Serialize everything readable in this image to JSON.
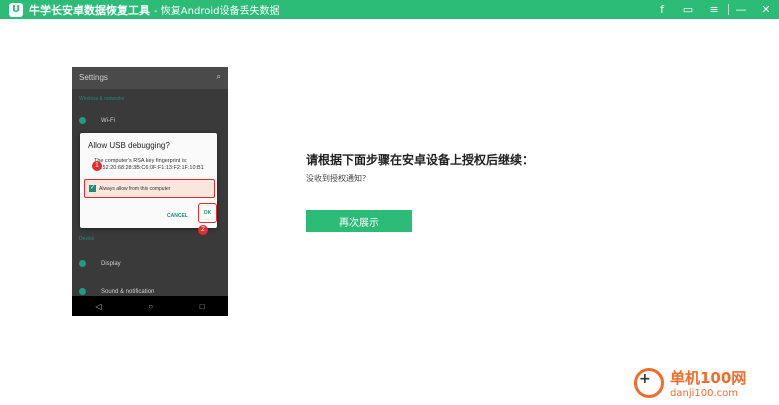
{
  "titlebar": {
    "logo_letter": "U",
    "app_name": "牛学长安卓数据恢复工具",
    "subtitle": "- 恢复Android设备丢失数据",
    "buttons": [
      {
        "name": "facebook-icon",
        "glyph": "f"
      },
      {
        "name": "feedback-icon",
        "glyph": "▭"
      },
      {
        "name": "menu-icon",
        "glyph": "≡"
      },
      {
        "name": "minimize-icon",
        "glyph": "—"
      },
      {
        "name": "close-icon",
        "glyph": "✕"
      }
    ]
  },
  "phone": {
    "toolbar_title": "Settings",
    "search_glyph": "⌕",
    "section_wireless": "Wireless & networks",
    "row_wifi": "Wi-Fi",
    "section_device": "Device",
    "row_display": "Display",
    "row_sound": "Sound & notification",
    "nav": [
      "◁",
      "○",
      "□"
    ],
    "dialog": {
      "title": "Allow USB debugging?",
      "text": "The computer's RSA key fingerprint is: 9C:52:20:68:28:3B:C6:0F:F1:13:F2:1F:10:B1",
      "checkbox_label": "Always allow from this computer",
      "cancel": "CANCEL",
      "ok": "OK"
    },
    "step_badges": [
      "1",
      "2"
    ]
  },
  "main": {
    "instruction": "请根据下面步骤在安卓设备上授权后继续：",
    "no_notice": "没收到授权通知？",
    "redisplay_button": "再次展示"
  },
  "watermark": {
    "name": "单机100网",
    "url": "danji100.com"
  },
  "colors": {
    "accent": "#2dbb78",
    "highlight": "#e02c2c",
    "watermark": "#f26b2a"
  }
}
